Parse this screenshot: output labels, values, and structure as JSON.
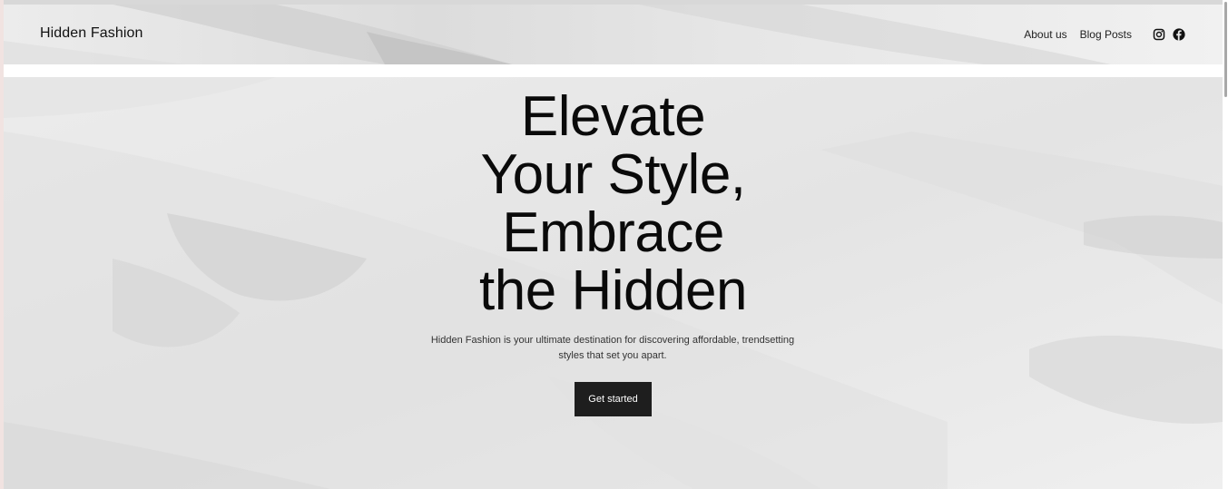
{
  "header": {
    "brand": "Hidden Fashion",
    "nav": [
      {
        "label": "About us"
      },
      {
        "label": "Blog Posts"
      }
    ],
    "social_icons": [
      "instagram-icon",
      "facebook-icon"
    ]
  },
  "hero": {
    "headline_lines": [
      "Elevate",
      "Your Style,",
      "Embrace",
      "the Hidden"
    ],
    "subtitle_line1": "Hidden Fashion is your ultimate destination for discovering affordable, trendsetting",
    "subtitle_line2": "styles that set you apart.",
    "cta_label": "Get started"
  },
  "colors": {
    "text": "#0a0a0a",
    "button_bg": "#1e1e1e",
    "button_text": "#ffffff",
    "background_texture": "#e9e9e9"
  }
}
